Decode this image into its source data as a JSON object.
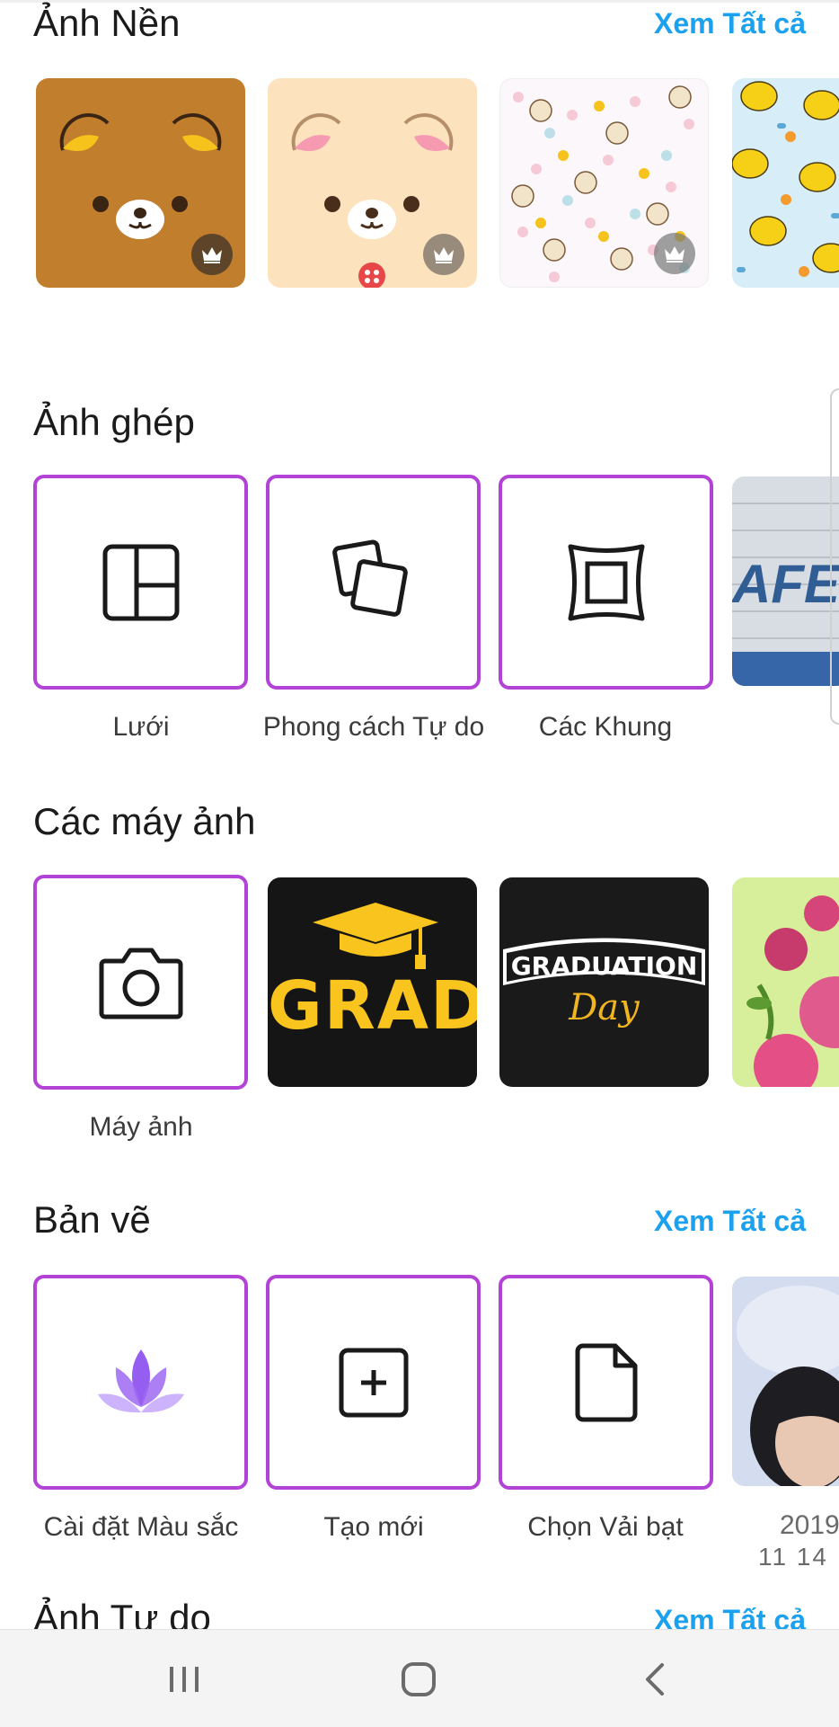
{
  "sections": {
    "wallpapers": {
      "title": "Ảnh Nền",
      "see_all": "Xem Tất cả"
    },
    "collage": {
      "title": "Ảnh ghép",
      "items": [
        {
          "label": "Lưới",
          "icon": "grid-icon"
        },
        {
          "label": "Phong cách Tự do",
          "icon": "freestyle-icon"
        },
        {
          "label": "Các Khung",
          "icon": "frame-icon"
        }
      ]
    },
    "cameras": {
      "title": "Các máy ảnh",
      "items": [
        {
          "label": "Máy ảnh",
          "icon": "camera-icon"
        }
      ],
      "grad_text": "GRAD",
      "graduation_text": "GRADUATION",
      "day_text": "Day"
    },
    "drawings": {
      "title": "Bản vẽ",
      "see_all": "Xem Tất cả",
      "items": [
        {
          "label": "Cài đặt Màu sắc",
          "icon": "lotus-icon"
        },
        {
          "label": "Tạo mới",
          "icon": "add-square-icon"
        },
        {
          "label": "Chọn Vải bạt",
          "icon": "document-icon"
        }
      ],
      "recent_date": "2019",
      "recent_date_2": "11  14"
    },
    "freestyle": {
      "title": "Ảnh Tự do",
      "see_all": "Xem Tất cả"
    }
  },
  "nav": {
    "recents": "recents-icon",
    "home": "home-icon",
    "back": "back-icon"
  },
  "colors": {
    "accent": "#1ba1ee",
    "tile_border": "#b243d6",
    "lotus": "#8a4df0"
  }
}
